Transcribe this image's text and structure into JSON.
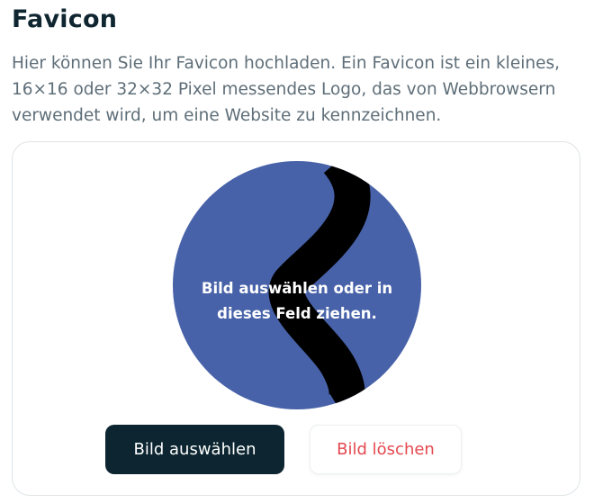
{
  "page": {
    "title": "Favicon",
    "description_lines": [
      "Hier können Sie Ihr Favicon hochladen. Ein Favicon ist ein kleines,",
      "16×16 oder 32×32 Pixel messendes Logo, das von Webbrowsern",
      "verwendet wird, um eine Website zu kennzeichnen."
    ]
  },
  "upload": {
    "dropzone_lines": [
      "Bild auswählen oder in",
      "dieses Feld ziehen."
    ],
    "select_button_label": "Bild auswählen",
    "delete_button_label": "Bild löschen"
  },
  "colors": {
    "title": "#0f2530",
    "description": "#5e6e78",
    "favicon_background": "#4862a9",
    "favicon_wave": "#000000",
    "primary_button": "#0c2530",
    "delete_text": "#e4484f"
  },
  "favicon_preview_icon": "wave-logo-icon"
}
